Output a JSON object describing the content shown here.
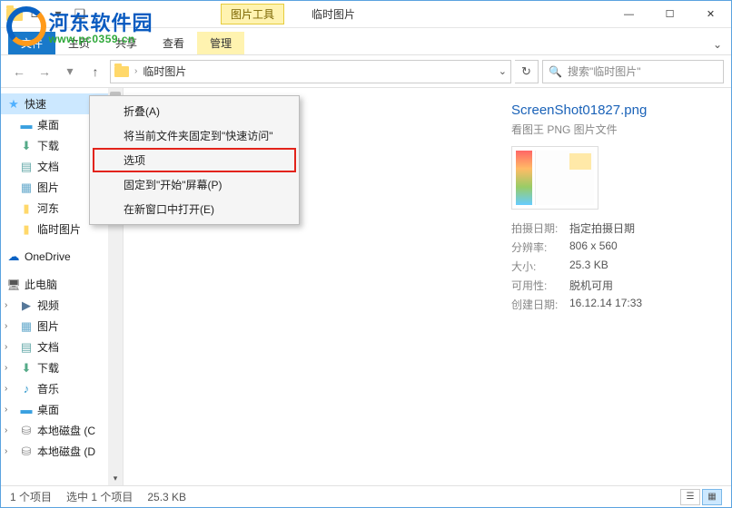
{
  "watermark": {
    "cn": "河东软件园",
    "url": "www.pc0359.cn"
  },
  "titlebar": {
    "context_tab": "图片工具",
    "title": "临时图片"
  },
  "ribbon": {
    "file": "文件",
    "tabs": [
      "主页",
      "共享",
      "查看"
    ],
    "context": "管理"
  },
  "address": {
    "crumb": "临时图片",
    "search_placeholder": "搜索\"临时图片\""
  },
  "sidebar": {
    "quick": "快速",
    "quick_items": [
      "桌面",
      "下载",
      "文档",
      "图片",
      "河东",
      "临时图片"
    ],
    "onedrive": "OneDrive",
    "thispc": "此电脑",
    "pc_items": [
      "视频",
      "图片",
      "文档",
      "下载",
      "音乐",
      "桌面",
      "本地磁盘 (C",
      "本地磁盘 (D"
    ]
  },
  "context_menu": {
    "items": [
      "折叠(A)",
      "将当前文件夹固定到\"快速访问\"",
      "选项",
      "固定到\"开始\"屏幕(P)",
      "在新窗口中打开(E)"
    ]
  },
  "preview": {
    "filename": "ScreenShot01827.png",
    "filetype": "看图王 PNG 图片文件",
    "props": [
      {
        "label": "拍摄日期:",
        "value": "指定拍摄日期"
      },
      {
        "label": "分辨率:",
        "value": "806 x 560"
      },
      {
        "label": "大小:",
        "value": "25.3 KB"
      },
      {
        "label": "可用性:",
        "value": "脱机可用"
      },
      {
        "label": "创建日期:",
        "value": "16.12.14 17:33"
      }
    ]
  },
  "status": {
    "count": "1 个项目",
    "selection": "选中 1 个项目",
    "size": "25.3 KB"
  }
}
